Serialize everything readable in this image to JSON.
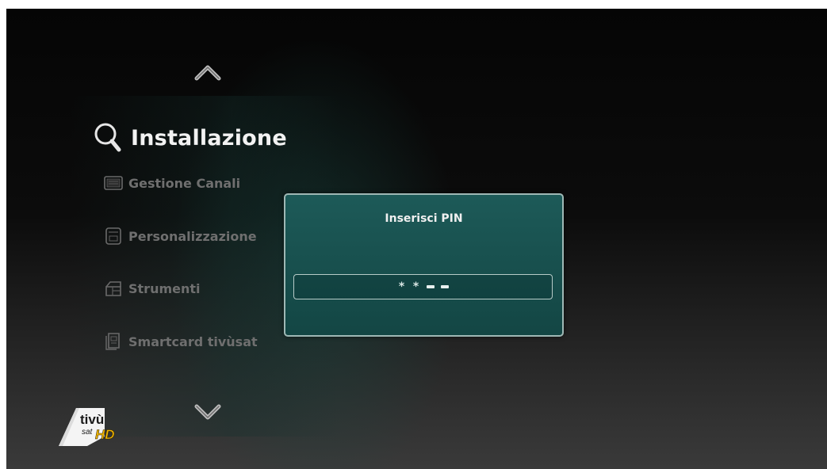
{
  "menu": {
    "title": "Installazione",
    "items": [
      {
        "label": "Gestione Canali",
        "icon": "channel-list-icon"
      },
      {
        "label": "Personalizzazione",
        "icon": "settings-panel-icon"
      },
      {
        "label": "Strumenti",
        "icon": "tools-icon"
      },
      {
        "label": "Smartcard tivùsat",
        "icon": "smartcard-icon"
      }
    ]
  },
  "dialog": {
    "title": "Inserisci PIN",
    "pin": {
      "entered_mask": [
        "*",
        "*"
      ],
      "remaining": 2
    }
  },
  "logo": {
    "line1": "tivù",
    "line2": "sat",
    "badge": "HD"
  },
  "colors": {
    "dialog_bg": "#1d5a58",
    "dialog_border": "#9fb8b5",
    "menu_title": "#f2f2f2",
    "menu_item": "#6f6f6f",
    "logo_hd": "#f2b600"
  }
}
